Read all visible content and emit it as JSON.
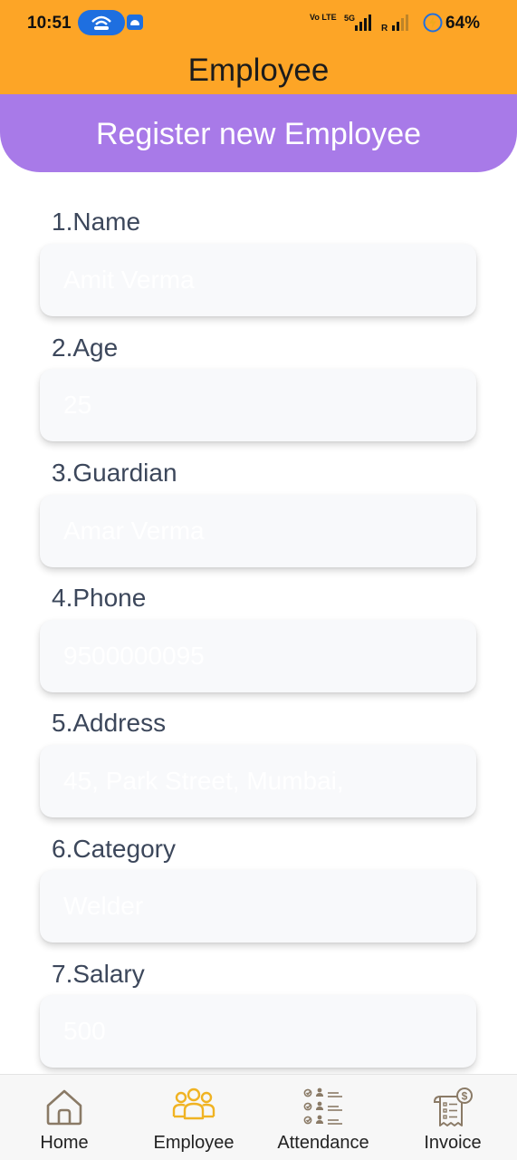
{
  "status_bar": {
    "time": "10:51",
    "volte": "Vo LTE",
    "network": "5G",
    "roaming": "R",
    "battery": "64%"
  },
  "app_bar": {
    "title": "Employee"
  },
  "banner": {
    "title": "Register new Employee"
  },
  "form": {
    "fields": [
      {
        "label": "1.Name",
        "placeholder": "Amit Verma",
        "value": ""
      },
      {
        "label": "2.Age",
        "placeholder": "25",
        "value": ""
      },
      {
        "label": "3.Guardian",
        "placeholder": "Amar Verma",
        "value": ""
      },
      {
        "label": "4.Phone",
        "placeholder": "9500000095",
        "value": ""
      },
      {
        "label": "5.Address",
        "placeholder": "45, Park Street, Mumbai,",
        "value": ""
      },
      {
        "label": "6.Category",
        "placeholder": "Welder",
        "value": ""
      },
      {
        "label": "7.Salary",
        "placeholder": "500",
        "value": ""
      }
    ]
  },
  "bottom_nav": {
    "active": "Employee",
    "items": [
      {
        "label": "Home",
        "icon": "home-icon"
      },
      {
        "label": "Employee",
        "icon": "employees-group-icon"
      },
      {
        "label": "Attendance",
        "icon": "attendance-checklist-icon"
      },
      {
        "label": "Invoice",
        "icon": "invoice-icon"
      }
    ]
  },
  "colors": {
    "app_bar": "#FDA526",
    "banner": "#A87AE8",
    "label_text": "#3C475B",
    "active_nav_icon": "#F0B323",
    "input_bg": "#F8F9FB"
  }
}
